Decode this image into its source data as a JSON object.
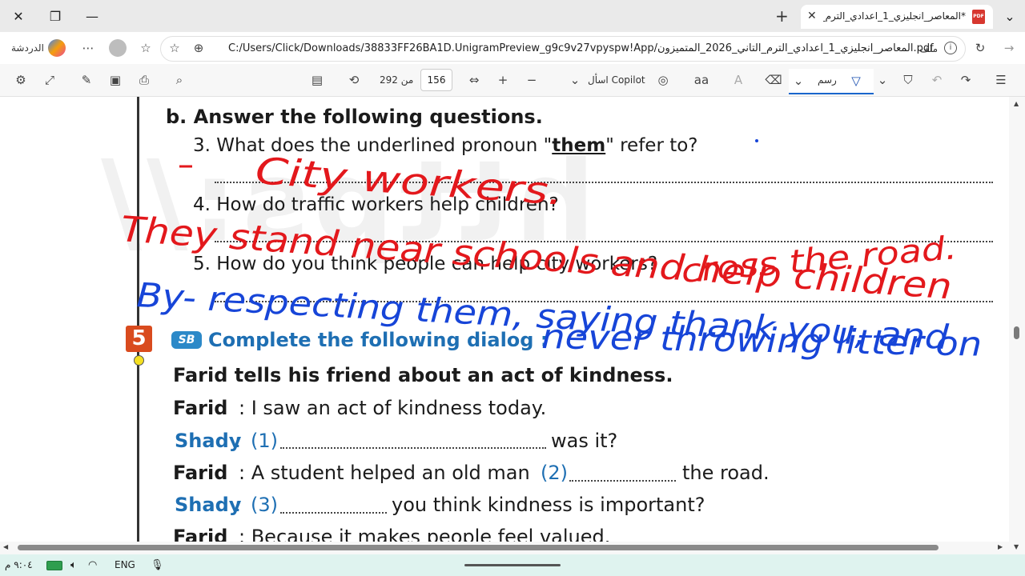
{
  "browser": {
    "tab_title": "*المعاصر_انجليزي_1_اعدادي_الترم_التا",
    "pdf_badge": "PDF",
    "url": "C:/Users/Click/Downloads/38833FF26BA1D.UnigramPreview_g9c9v27vpyspw!App/المعاصر_انجليزي_1_اعدادي_الترم_التاني_2026_المتميزون.pdf",
    "file_label": "ملف",
    "chat_label": "الدردشة"
  },
  "pdf_toolbar": {
    "page_current": "156",
    "page_of": "من 292",
    "copilot_label": "اسأل Copilot",
    "draw_label": "رسم",
    "read_aloud_icon": "aa"
  },
  "doc": {
    "section_b": "b.  Answer the following questions.",
    "q3_a": "3. What does the underlined pronoun \"",
    "q3_them": "them",
    "q3_b": "\" refer to?",
    "q4": "4. How do traffic workers help children?",
    "q5": "5. How do you think people can help city workers?",
    "ex_num": "5",
    "sb_badge": "SB",
    "ex_title": "Complete the following dialog :",
    "intro": "Farid tells his friend about an act of kindness.",
    "d1_speaker": "Farid",
    "d1_text": ": I saw an act of kindness today.",
    "d2_speaker": "Shady",
    "d2_colon": ":",
    "d2_num": "(1)",
    "d2_text": "was it?",
    "d3_speaker": "Farid",
    "d3_text_a": ": A student helped an old man",
    "d3_num": "(2)",
    "d3_text_b": "the road.",
    "d4_speaker": "Shady",
    "d4_colon": ":",
    "d4_num": "(3)",
    "d4_text": "you think kindness is important?",
    "d5_speaker": "Farid",
    "d5_text": ": Because it makes people feel valued."
  },
  "ink": {
    "answer_3": "City workers.",
    "answer_4_line1": "They stand near schools and help children",
    "answer_4_line2": "cross the road.",
    "answer_5_line1": "By- respecting them, saying thank you, and",
    "answer_5_line2": "never throwing litter on",
    "colors": {
      "red": "#e3181c",
      "blue": "#1745d8"
    }
  },
  "taskbar": {
    "time": "٩:٠٤ م",
    "lang": "ENG"
  },
  "icons": [
    "close-icon",
    "restore-icon",
    "minimize-icon",
    "new-tab-icon",
    "pdf-icon",
    "copilot-icon",
    "profile-icon",
    "favorites-icon",
    "info-icon",
    "refresh-icon",
    "forward-icon",
    "settings-icon",
    "expand-icon",
    "edit-icon",
    "save-icon",
    "print-icon",
    "search-icon",
    "page-view-icon",
    "rotate-icon",
    "fit-width-icon",
    "zoom-in-icon",
    "zoom-out-icon",
    "eraser-icon",
    "highlighter-icon",
    "pen-icon",
    "undo-icon",
    "redo-icon",
    "more-icon",
    "battery-icon",
    "volume-icon",
    "wifi-icon",
    "mic-icon"
  ]
}
